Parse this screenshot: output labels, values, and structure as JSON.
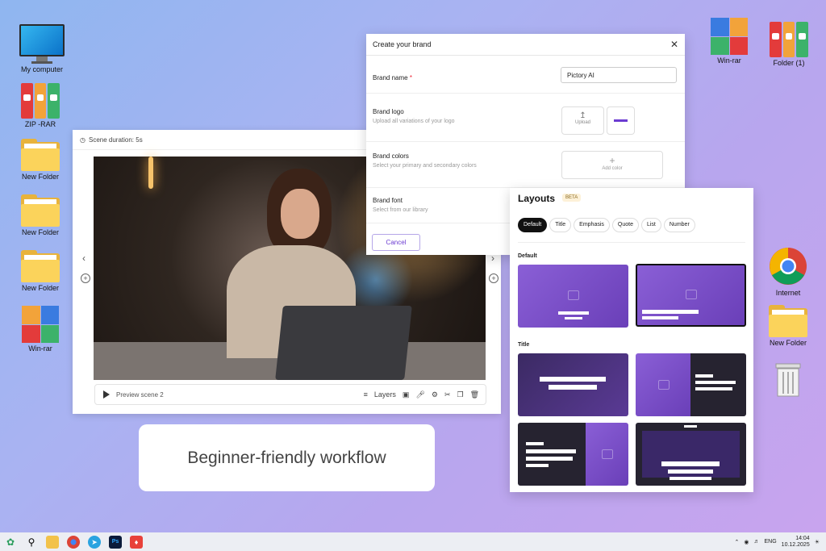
{
  "desktop_left": [
    {
      "label": "My computer",
      "type": "monitor"
    },
    {
      "label": "ZIP -RAR",
      "type": "binders"
    },
    {
      "label": "New Folder",
      "type": "folder"
    },
    {
      "label": "New Folder",
      "type": "folder"
    },
    {
      "label": "New Folder",
      "type": "folder"
    },
    {
      "label": "Win-rar",
      "type": "winrar"
    }
  ],
  "desktop_right": [
    {
      "label": "Win-rar",
      "type": "winrar"
    },
    {
      "label": "Folder (1)",
      "type": "binders"
    },
    {
      "label": "Internet",
      "type": "chrome"
    },
    {
      "label": "New Folder",
      "type": "folder"
    },
    {
      "label": "Recycle bin",
      "type": "trash"
    }
  ],
  "scene": {
    "duration_label": "Scene duration: 5s",
    "preview_label": "Preview scene 2",
    "layers_label": "Layers"
  },
  "brand": {
    "title": "Create your brand",
    "name_label": "Brand name",
    "name_required": "*",
    "name_value": "Pictory AI",
    "logo_label": "Brand logo",
    "logo_sub": "Upload all variations of your logo",
    "upload_label": "Upload",
    "colors_label": "Brand colors",
    "colors_sub": "Select your primary and secondary colors",
    "add_color_label": "Add color",
    "font_label": "Brand font",
    "font_sub": "Select from our library",
    "cancel_label": "Cancel"
  },
  "layouts": {
    "title": "Layouts",
    "badge": "BETA",
    "chips": [
      "Default",
      "Title",
      "Emphasis",
      "Quote",
      "List",
      "Number"
    ],
    "section_default": "Default",
    "section_title": "Title"
  },
  "tagline": "Beginner-friendly workflow",
  "taskbar": {
    "lang": "ENG",
    "time": "14:04",
    "date": "10.12.2025"
  },
  "colors": {
    "accent": "#6b3bd1",
    "purple": "#7b4fcc"
  }
}
